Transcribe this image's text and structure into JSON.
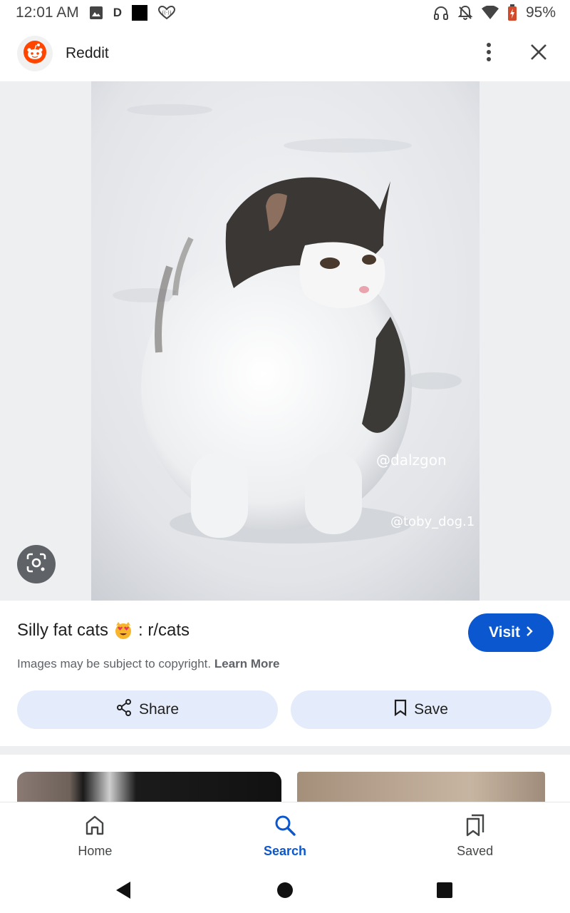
{
  "status_bar": {
    "time": "12:01 AM",
    "d_label": "D",
    "battery": "95%"
  },
  "header": {
    "site_name": "Reddit",
    "icons": [
      "reddit-logo-icon",
      "more-vert-icon",
      "close-icon"
    ]
  },
  "image": {
    "watermark_1": "@dalzgon",
    "watermark_2": "@toby_dog.1"
  },
  "result": {
    "title_before": "Silly fat cats",
    "title_emoji": "😻",
    "title_after": ": r/cats",
    "visit_label": "Visit",
    "copyright_text": "Images may be subject to copyright.",
    "learn_more": "Learn More",
    "share_label": "Share",
    "save_label": "Save"
  },
  "bottom_nav": {
    "items": [
      {
        "label": "Home",
        "icon": "home-icon",
        "active": false
      },
      {
        "label": "Search",
        "icon": "search-icon",
        "active": true
      },
      {
        "label": "Saved",
        "icon": "saved-icon",
        "active": false
      }
    ]
  },
  "colors": {
    "accent": "#0b57d0",
    "tonal_button": "#e4ebfa",
    "image_backdrop": "#eeeff1"
  }
}
